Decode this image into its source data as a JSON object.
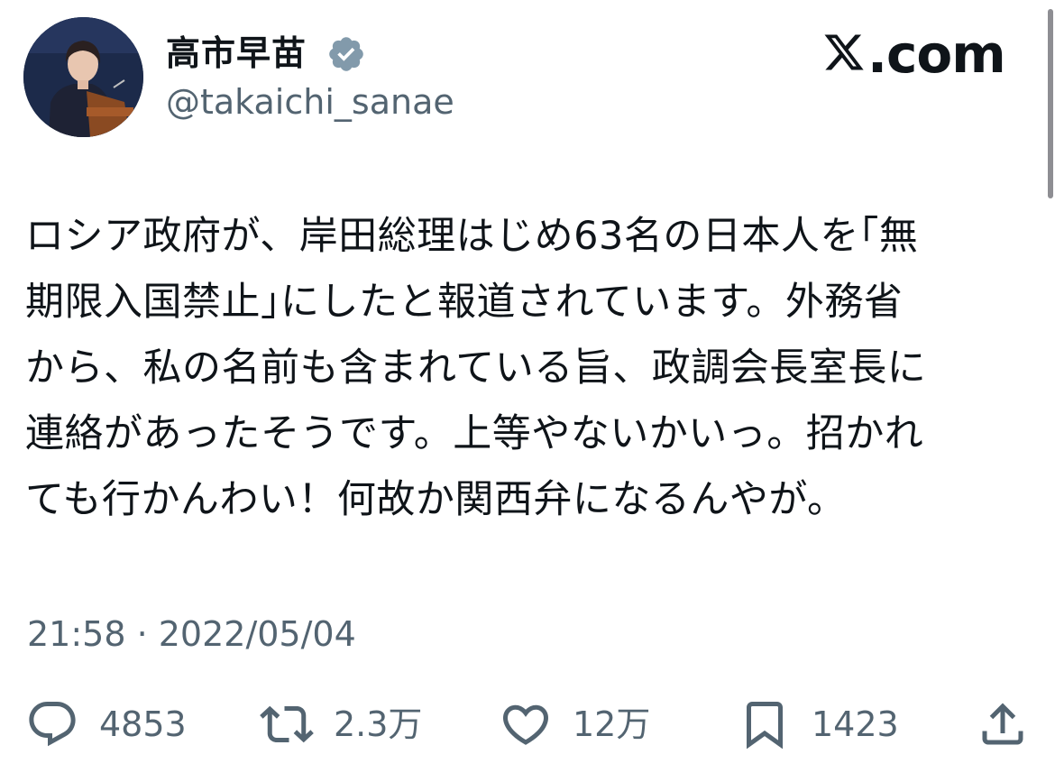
{
  "author": {
    "display_name": "高市早苗",
    "handle": "@takaichi_sanae",
    "verified": true,
    "verified_color": "#829aab"
  },
  "brand": {
    "domain": ".com",
    "logo_icon": "x-logo-icon"
  },
  "tweet": {
    "text": "ロシア政府が、岸田総理はじめ63名の日本人を｢無\n期限入国禁止｣にしたと報道されています。外務省\nから、私の名前も含まれている旨、政調会長室長に\n連絡があったそうです。上等やないかいっ。招かれ\nても行かんわい！何故か関西弁になるんやが。",
    "timestamp": "21:58 · 2022/05/04"
  },
  "actions": {
    "reply": {
      "icon": "reply-icon",
      "count": "4853"
    },
    "retweet": {
      "icon": "retweet-icon",
      "count": "2.3万"
    },
    "like": {
      "icon": "heart-icon",
      "count": "12万"
    },
    "bookmark": {
      "icon": "bookmark-icon",
      "count": "1423"
    },
    "share": {
      "icon": "share-icon"
    }
  },
  "colors": {
    "text": "#0f1419",
    "secondary": "#536471",
    "background": "#ffffff"
  }
}
